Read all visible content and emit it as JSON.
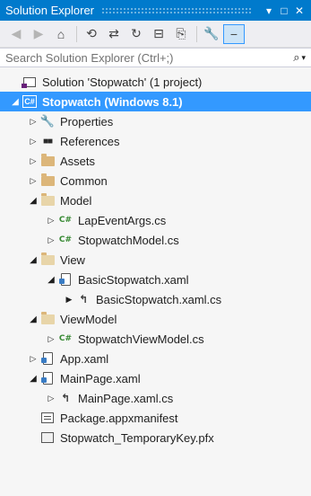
{
  "window": {
    "title": "Solution Explorer",
    "dropdown_glyph": "▾",
    "pin_glyph": "□",
    "close_glyph": "✕"
  },
  "toolbar": {
    "back_icon": "◀",
    "forward_icon": "▶",
    "home_icon": "⌂",
    "pending_changes_icon": "⟲",
    "sync_icon": "⇄",
    "refresh_icon": "↻",
    "collapse_all_icon": "⊟",
    "show_all_files_icon": "⎘",
    "properties_icon": "🔧",
    "preview_icon": "−"
  },
  "search": {
    "placeholder": "Search Solution Explorer (Ctrl+;)",
    "value": "",
    "icon": "⌕",
    "dropdown": "▾"
  },
  "tree": [
    {
      "level": 0,
      "arrow": "",
      "icon": "solution-icon",
      "label": "Solution 'Stopwatch' (1 project)",
      "selected": false
    },
    {
      "level": 0,
      "arrow": "◢",
      "icon": "csharp-project-icon",
      "label": "Stopwatch (Windows 8.1)",
      "selected": true
    },
    {
      "level": 1,
      "arrow": "▷",
      "icon": "wrench-icon",
      "label": "Properties",
      "selected": false
    },
    {
      "level": 1,
      "arrow": "▷",
      "icon": "references-icon",
      "label": "References",
      "selected": false
    },
    {
      "level": 1,
      "arrow": "▷",
      "icon": "folder-icon",
      "label": "Assets",
      "selected": false
    },
    {
      "level": 1,
      "arrow": "▷",
      "icon": "folder-icon",
      "label": "Common",
      "selected": false
    },
    {
      "level": 1,
      "arrow": "◢",
      "icon": "folder-open-icon",
      "label": "Model",
      "selected": false
    },
    {
      "level": 2,
      "arrow": "▷",
      "icon": "csharp-file-icon",
      "label": "LapEventArgs.cs",
      "selected": false
    },
    {
      "level": 2,
      "arrow": "▷",
      "icon": "csharp-file-icon",
      "label": "StopwatchModel.cs",
      "selected": false
    },
    {
      "level": 1,
      "arrow": "◢",
      "icon": "folder-open-icon",
      "label": "View",
      "selected": false
    },
    {
      "level": 2,
      "arrow": "◢",
      "icon": "xaml-file-icon",
      "label": "BasicStopwatch.xaml",
      "selected": false
    },
    {
      "level": 3,
      "arrow": "▶",
      "icon": "code-behind-icon",
      "label": "BasicStopwatch.xaml.cs",
      "selected": false
    },
    {
      "level": 1,
      "arrow": "◢",
      "icon": "folder-open-icon",
      "label": "ViewModel",
      "selected": false
    },
    {
      "level": 2,
      "arrow": "▷",
      "icon": "csharp-file-icon",
      "label": "StopwatchViewModel.cs",
      "selected": false
    },
    {
      "level": 1,
      "arrow": "▷",
      "icon": "xaml-file-icon",
      "label": "App.xaml",
      "selected": false
    },
    {
      "level": 1,
      "arrow": "◢",
      "icon": "xaml-file-icon",
      "label": "MainPage.xaml",
      "selected": false
    },
    {
      "level": 2,
      "arrow": "▷",
      "icon": "code-behind-icon",
      "label": "MainPage.xaml.cs",
      "selected": false
    },
    {
      "level": 1,
      "arrow": "",
      "icon": "manifest-icon",
      "label": "Package.appxmanifest",
      "selected": false
    },
    {
      "level": 1,
      "arrow": "",
      "icon": "certificate-icon",
      "label": "Stopwatch_TemporaryKey.pfx",
      "selected": false
    }
  ],
  "colors": {
    "accent": "#007acc",
    "selection": "#3399ff",
    "folder": "#dcb67a",
    "csharp": "#388a34"
  }
}
